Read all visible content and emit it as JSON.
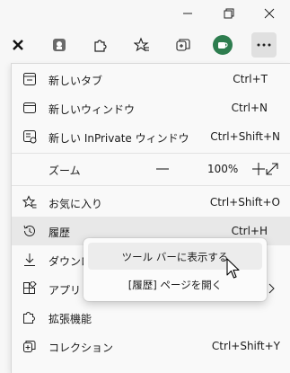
{
  "menu": {
    "new_tab": {
      "label": "新しいタブ",
      "shortcut": "Ctrl+T"
    },
    "new_window": {
      "label": "新しいウィンドウ",
      "shortcut": "Ctrl+N"
    },
    "new_inprivate": {
      "label": "新しい InPrivate ウィンドウ",
      "shortcut": "Ctrl+Shift+N"
    },
    "zoom": {
      "label": "ズーム",
      "minus": "—",
      "value": "100%",
      "plus": "+"
    },
    "favorites": {
      "label": "お気に入り",
      "shortcut": "Ctrl+Shift+O"
    },
    "history": {
      "label": "履歴",
      "shortcut": "Ctrl+H"
    },
    "downloads": {
      "label": "ダウンロー"
    },
    "apps": {
      "label": "アプリ"
    },
    "extensions": {
      "label": "拡張機能"
    },
    "collections": {
      "label": "コレクション",
      "shortcut": "Ctrl+Shift+Y"
    }
  },
  "submenu": {
    "show_in_toolbar": "ツール バーに表示する",
    "open_history_page": "[履歴] ページを開く"
  },
  "colors": {
    "accent_profile": "#2e7d4f",
    "hover": "#e8e8e8"
  }
}
